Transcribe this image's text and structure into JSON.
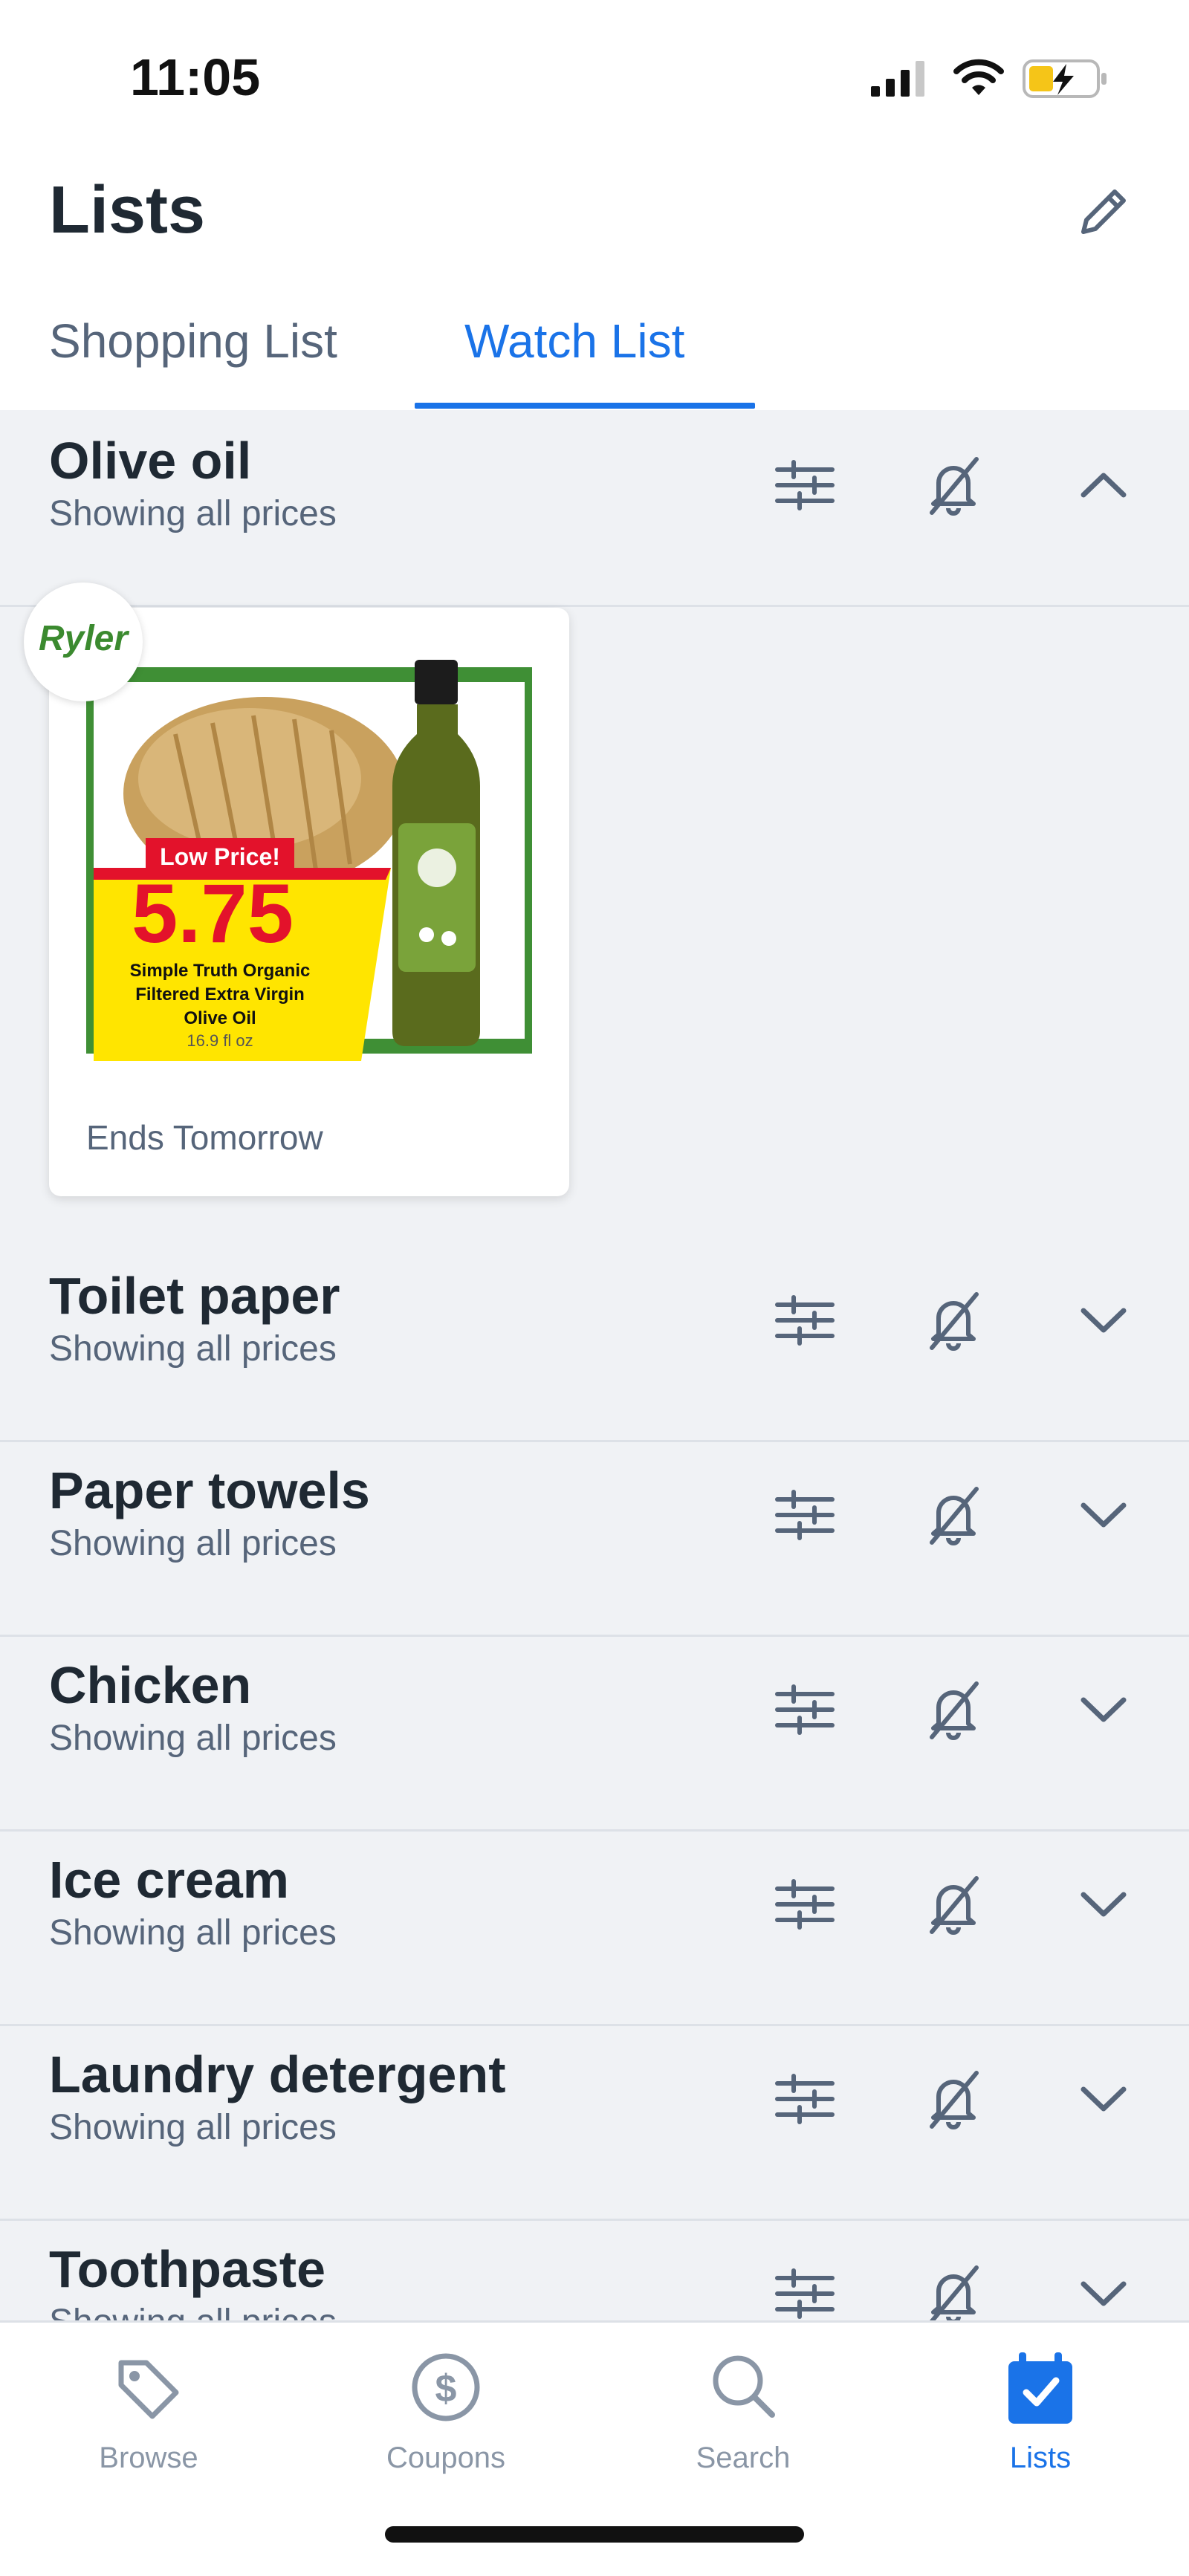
{
  "status_bar": {
    "time": "11:05"
  },
  "header": {
    "title": "Lists",
    "tabs": [
      {
        "label": "Shopping List",
        "active": false
      },
      {
        "label": "Watch List",
        "active": true
      }
    ]
  },
  "watch_list": [
    {
      "name": "Olive oil",
      "subtitle": "Showing all prices",
      "expanded": true
    },
    {
      "name": "Toilet paper",
      "subtitle": "Showing all prices",
      "expanded": false
    },
    {
      "name": "Paper towels",
      "subtitle": "Showing all prices",
      "expanded": false
    },
    {
      "name": "Chicken",
      "subtitle": "Showing all prices",
      "expanded": false
    },
    {
      "name": "Ice cream",
      "subtitle": "Showing all prices",
      "expanded": false
    },
    {
      "name": "Laundry detergent",
      "subtitle": "Showing all prices",
      "expanded": false
    },
    {
      "name": "Toothpaste",
      "subtitle": "Showing all prices",
      "expanded": false
    }
  ],
  "deal_card": {
    "store_logo": "Ryler",
    "badge": "Low Price!",
    "price": "5.75",
    "product_lines": [
      "Simple Truth Organic",
      "Filtered Extra Virgin",
      "Olive Oil"
    ],
    "size": "16.9 fl oz",
    "ends": "Ends Tomorrow"
  },
  "bottom_nav": [
    {
      "label": "Browse",
      "icon": "tag-icon",
      "active": false
    },
    {
      "label": "Coupons",
      "icon": "dollar-circle-icon",
      "active": false
    },
    {
      "label": "Search",
      "icon": "search-icon",
      "active": false
    },
    {
      "label": "Lists",
      "icon": "calendar-check-icon",
      "active": true
    }
  ],
  "colors": {
    "accent": "#1a73e8",
    "background": "#f0f2f5",
    "muted": "#56657a",
    "promo_yellow": "#ffe500",
    "promo_red": "#e3122b",
    "frame_green": "#3f8f35"
  }
}
